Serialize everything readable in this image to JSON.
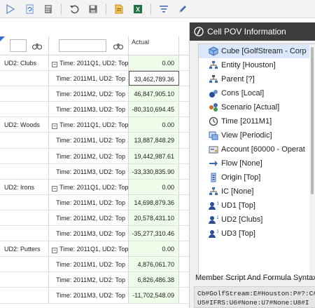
{
  "toolbar": {
    "buttons": [
      {
        "name": "send-icon"
      },
      {
        "name": "refresh-page-icon"
      },
      {
        "name": "calculator-icon"
      },
      {
        "name": "undo-icon"
      },
      {
        "name": "save-icon"
      },
      {
        "name": "document-icon"
      },
      {
        "name": "excel-icon",
        "label": "X"
      },
      {
        "name": "filter-icon"
      },
      {
        "name": "pencil-icon"
      }
    ]
  },
  "grid": {
    "column_header": "Actual",
    "rows": [
      {
        "ud2": "UD2: Clubs",
        "time": "Time: 2011Q1, UD2: Top",
        "value": "0.00",
        "kind": "parent"
      },
      {
        "ud2": "",
        "time": "Time: 2011M1, UD2: Top",
        "value": "33,462,789.36",
        "kind": "child",
        "selected": true
      },
      {
        "ud2": "",
        "time": "Time: 2011M2, UD2: Top",
        "value": "46,847,905.10",
        "kind": "child"
      },
      {
        "ud2": "",
        "time": "Time: 2011M3, UD2: Top",
        "value": "-80,310,694.45",
        "kind": "child"
      },
      {
        "ud2": "UD2: Woods",
        "time": "Time: 2011Q1, UD2: Top",
        "value": "0.00",
        "kind": "parent"
      },
      {
        "ud2": "",
        "time": "Time: 2011M1, UD2: Top",
        "value": "13,887,848.29",
        "kind": "child"
      },
      {
        "ud2": "",
        "time": "Time: 2011M2, UD2: Top",
        "value": "19,442,987.61",
        "kind": "child"
      },
      {
        "ud2": "",
        "time": "Time: 2011M3, UD2: Top",
        "value": "-33,330,835.90",
        "kind": "child"
      },
      {
        "ud2": "UD2: Irons",
        "time": "Time: 2011Q1, UD2: Top",
        "value": "0.00",
        "kind": "parent"
      },
      {
        "ud2": "",
        "time": "Time: 2011M1, UD2: Top",
        "value": "14,698,879.36",
        "kind": "child"
      },
      {
        "ud2": "",
        "time": "Time: 2011M2, UD2: Top",
        "value": "20,578,431.10",
        "kind": "child"
      },
      {
        "ud2": "",
        "time": "Time: 2011M3, UD2: Top",
        "value": "-35,277,310.46",
        "kind": "child"
      },
      {
        "ud2": "UD2: Putters",
        "time": "Time: 2011Q1, UD2: Top",
        "value": "0.00",
        "kind": "parent"
      },
      {
        "ud2": "",
        "time": "Time: 2011M1, UD2: Top",
        "value": "4,876,061.70",
        "kind": "child"
      },
      {
        "ud2": "",
        "time": "Time: 2011M2, UD2: Top",
        "value": "6,826,486.38",
        "kind": "child"
      },
      {
        "ud2": "",
        "time": "Time: 2011M3, UD2: Top",
        "value": "-11,702,548.09",
        "kind": "child"
      }
    ]
  },
  "pov_panel": {
    "title": "Cell POV Information",
    "items": [
      {
        "icon": "cube-icon",
        "label": "Cube [GolfStream - Corp",
        "active": true
      },
      {
        "icon": "entity-icon",
        "label": "Entity [Houston]"
      },
      {
        "icon": "parent-icon",
        "label": "Parent [?]"
      },
      {
        "icon": "cons-icon",
        "label": "Cons [Local]"
      },
      {
        "icon": "scenario-icon",
        "label": "Scenario [Actual]"
      },
      {
        "icon": "clock-icon",
        "label": "Time [2011M1]"
      },
      {
        "icon": "view-icon",
        "label": "View [Periodic]"
      },
      {
        "icon": "account-icon",
        "label": "Account [60000 - Operat"
      },
      {
        "icon": "flow-icon",
        "label": "Flow [None]"
      },
      {
        "icon": "origin-icon",
        "label": "Origin [Top]"
      },
      {
        "icon": "ic-icon",
        "label": "IC [None]"
      },
      {
        "icon": "ud1-icon",
        "label": "UD1 [Top]"
      },
      {
        "icon": "ud2-icon",
        "label": "UD2 [Clubs]"
      },
      {
        "icon": "ud3-icon",
        "label": "UD3 [Top]"
      }
    ],
    "member_script_label": "Member Script And Formula Syntax",
    "member_script_text": "Cb#GolfStream:E#Houston:P#?:C#\nU5#IFRS:U6#None:U7#None:U8#I"
  }
}
